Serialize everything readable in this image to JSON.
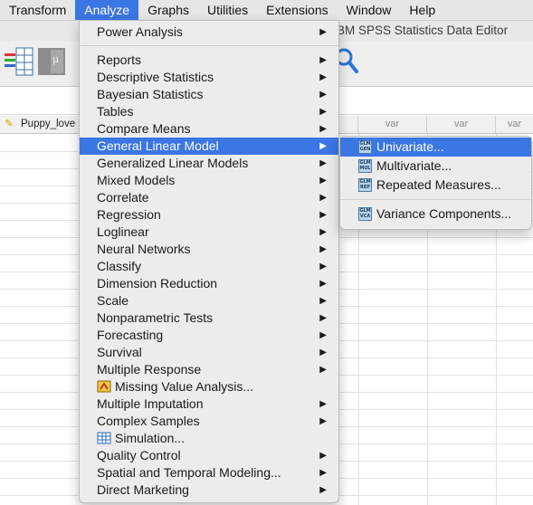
{
  "menubar": {
    "items": [
      {
        "label": "Transform"
      },
      {
        "label": "Analyze"
      },
      {
        "label": "Graphs"
      },
      {
        "label": "Utilities"
      },
      {
        "label": "Extensions"
      },
      {
        "label": "Window"
      },
      {
        "label": "Help"
      }
    ]
  },
  "window": {
    "title": "BM SPSS Statistics Data Editor"
  },
  "grid": {
    "first_column": "Puppy_love",
    "headers": [
      "var",
      "var",
      "var"
    ]
  },
  "analyze_menu": {
    "power_analysis": "Power Analysis",
    "items": [
      {
        "label": "Reports"
      },
      {
        "label": "Descriptive Statistics"
      },
      {
        "label": "Bayesian Statistics"
      },
      {
        "label": "Tables"
      },
      {
        "label": "Compare Means"
      },
      {
        "label": "General Linear Model"
      },
      {
        "label": "Generalized Linear Models"
      },
      {
        "label": "Mixed Models"
      },
      {
        "label": "Correlate"
      },
      {
        "label": "Regression"
      },
      {
        "label": "Loglinear"
      },
      {
        "label": "Neural Networks"
      },
      {
        "label": "Classify"
      },
      {
        "label": "Dimension Reduction"
      },
      {
        "label": "Scale"
      },
      {
        "label": "Nonparametric Tests"
      },
      {
        "label": "Forecasting"
      },
      {
        "label": "Survival"
      },
      {
        "label": "Multiple Response"
      },
      {
        "label": "Missing Value Analysis..."
      },
      {
        "label": "Multiple Imputation"
      },
      {
        "label": "Complex Samples"
      },
      {
        "label": "Simulation..."
      },
      {
        "label": "Quality Control"
      },
      {
        "label": "Spatial and Temporal Modeling..."
      },
      {
        "label": "Direct Marketing"
      }
    ],
    "highlighted": "General Linear Model"
  },
  "glm_submenu": {
    "items": [
      {
        "label": "Univariate...",
        "icon_text": "GLM GEN"
      },
      {
        "label": "Multivariate...",
        "icon_text": "GLM MUL"
      },
      {
        "label": "Repeated Measures...",
        "icon_text": "GLM REP"
      },
      {
        "label": "Variance Components...",
        "icon_text": "GLM VCA"
      }
    ]
  },
  "colors": {
    "highlight": "#3a76e4",
    "menu_bg": "#ececec"
  }
}
